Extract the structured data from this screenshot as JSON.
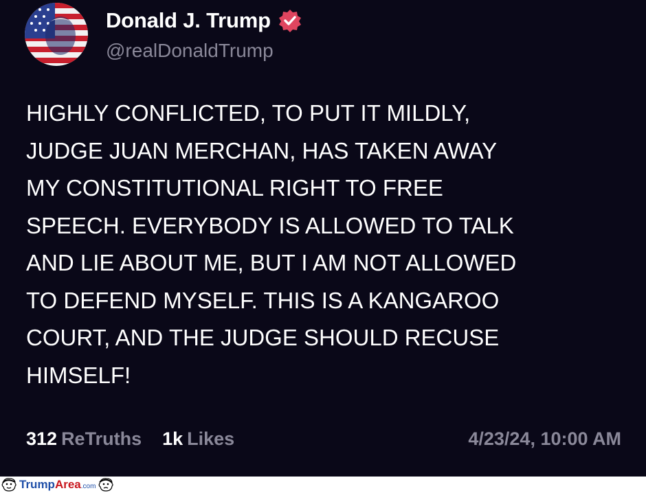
{
  "author": {
    "display_name": "Donald J. Trump",
    "handle": "@realDonaldTrump",
    "verified_badge_color": "#e0455f",
    "avatar_icon": "flag-portrait-avatar"
  },
  "post": {
    "body": "HIGHLY CONFLICTED, TO PUT IT MILDLY,\nJUDGE JUAN MERCHAN, HAS TAKEN AWAY\nMY CONSTITUTIONAL RIGHT TO FREE\nSPEECH. EVERYBODY IS ALLOWED TO TALK\nAND LIE ABOUT ME, BUT I AM NOT ALLOWED\nTO DEFEND MYSELF. THIS IS A KANGAROO\nCOURT, AND THE JUDGE SHOULD RECUSE\nHIMSELF!"
  },
  "stats": {
    "retruths_count": "312",
    "retruths_label": "ReTruths",
    "likes_count": "1k",
    "likes_label": "Likes",
    "timestamp": "4/23/24, 10:00 AM"
  },
  "watermark": {
    "brand_part1": "Trump",
    "brand_part2": "Area",
    "brand_part3": ".com"
  },
  "colors": {
    "background": "#0a0818",
    "text_primary": "#ffffff",
    "text_secondary": "#8a8899"
  }
}
